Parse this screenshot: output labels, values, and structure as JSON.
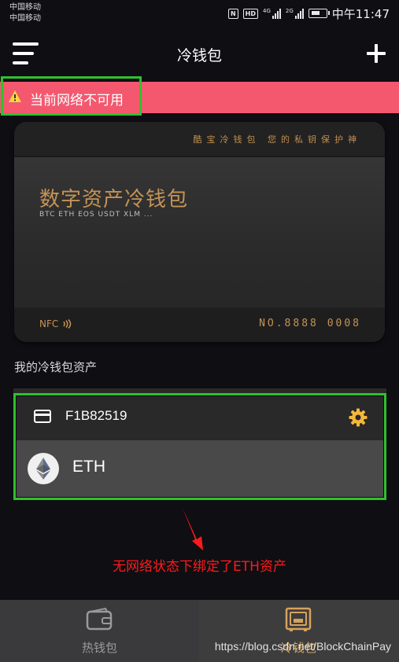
{
  "status_bar": {
    "carrier_line1": "中国移动",
    "carrier_line2": "中国移动",
    "nfc_label": "N",
    "hd_label": "HD",
    "network1_label": "4G",
    "network2_label": "2G",
    "time": "中午11:47"
  },
  "header": {
    "title": "冷钱包",
    "menu_icon": "hamburger-menu-icon",
    "add_icon": "plus-icon"
  },
  "network_banner": {
    "message": "当前网络不可用",
    "icon": "warning-icon",
    "background": "#f3586f"
  },
  "card": {
    "slogan": "酷宝冷钱包  您的私钥保护神",
    "title": "数字资产冷钱包",
    "supported_coins": "BTC ETH EOS USDT XLM ...",
    "nfc_label": "NFC",
    "card_number": "NO.8888 0008",
    "accent_color": "#c49456"
  },
  "assets_section": {
    "label": "我的冷钱包资产",
    "wallet": {
      "name": "F1B82519",
      "icon": "card-icon",
      "settings_icon": "gear-icon"
    },
    "assets": [
      {
        "symbol": "ETH",
        "icon": "ethereum-logo-icon"
      }
    ]
  },
  "annotation": {
    "text": "无网络状态下绑定了ETH资产",
    "color": "#ff1a1a"
  },
  "bottom_nav": {
    "tabs": [
      {
        "label": "热钱包",
        "icon": "wallet-icon",
        "active": false
      },
      {
        "label": "冷钱包",
        "icon": "safe-icon",
        "active": true
      }
    ],
    "active_color": "#d6a35c"
  },
  "watermark": "https://blog.csdn.net/BlockChainPay"
}
